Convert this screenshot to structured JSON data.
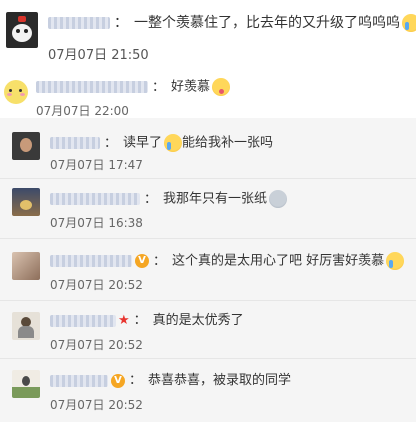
{
  "comments": [
    {
      "id": "c1",
      "text": "一整个羡慕住了，比去年的又升级了呜呜呜",
      "time": "07月07日 21:50",
      "emoji": "crying-face-emoji"
    },
    {
      "id": "c2",
      "text": "好羡慕",
      "time": "07月07日 22:00",
      "emoji": "tongue-out-emoji"
    },
    {
      "id": "c3",
      "text_a": "读早了",
      "text_b": "能给我补一张吗",
      "time": "07月07日 17:47",
      "emoji": "crying-face-emoji"
    },
    {
      "id": "c4",
      "text": "我那年只有一张纸",
      "time": "07月07日 16:38",
      "emoji": "sad-face-emoji"
    },
    {
      "id": "c5",
      "text": "这个真的是太用心了吧 好厉害好羡慕",
      "time": "07月07日 20:52",
      "emoji": "crying-face-emoji",
      "badge": "V"
    },
    {
      "id": "c6",
      "text": "真的是太优秀了",
      "time": "07月07日 20:52",
      "badge": "★"
    },
    {
      "id": "c7",
      "text": "恭喜恭喜，被录取的同学",
      "time": "07月07日 20:52",
      "badge": "V"
    }
  ],
  "separator": "：",
  "colors": {
    "text": "#333333",
    "time": "#666666",
    "reply_bg": "#f5f5f5",
    "badge": "#f5a623",
    "star": "#e8342f"
  }
}
